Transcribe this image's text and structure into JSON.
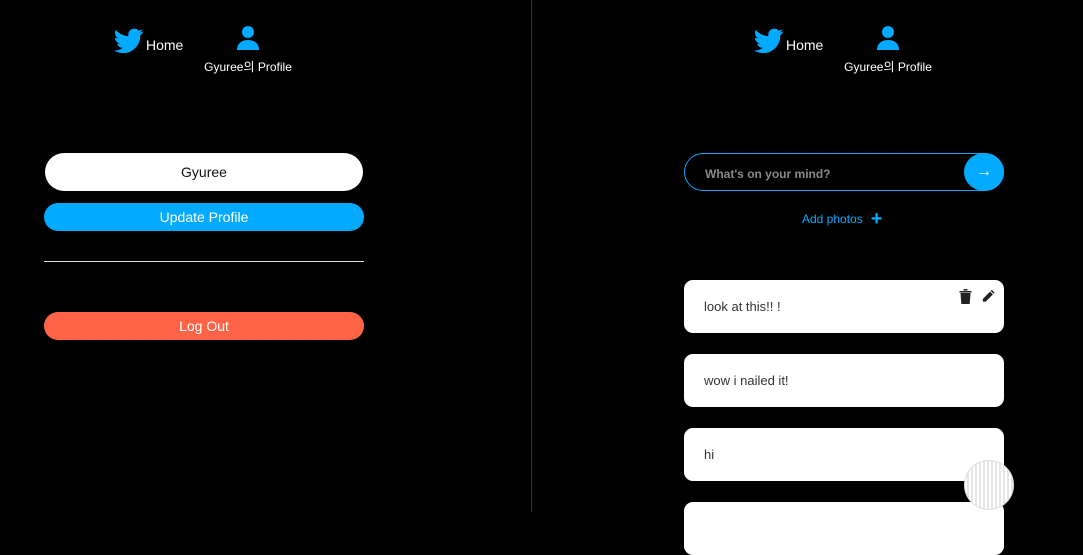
{
  "colors": {
    "accent": "#04aaff",
    "danger": "#ff6347",
    "background": "#000000"
  },
  "left": {
    "nav": {
      "home_label": "Home",
      "home_icon": "twitter-bird-icon",
      "profile_label": "Gyuree의 Profile",
      "profile_icon": "user-icon"
    },
    "profile_form": {
      "name_value": "Gyuree",
      "update_label": "Update Profile"
    },
    "logout_label": "Log Out"
  },
  "right": {
    "nav": {
      "home_label": "Home",
      "home_icon": "twitter-bird-icon",
      "profile_label": "Gyuree의 Profile",
      "profile_icon": "user-icon"
    },
    "compose": {
      "placeholder": "What's on your mind?",
      "submit_label": "→",
      "add_photos_label": "Add photos",
      "add_photos_icon": "+"
    },
    "tweets": [
      {
        "text": "look at this!! !"
      },
      {
        "text": "wow i nailed it!"
      },
      {
        "text": "hi"
      },
      {
        "text": ""
      }
    ]
  }
}
